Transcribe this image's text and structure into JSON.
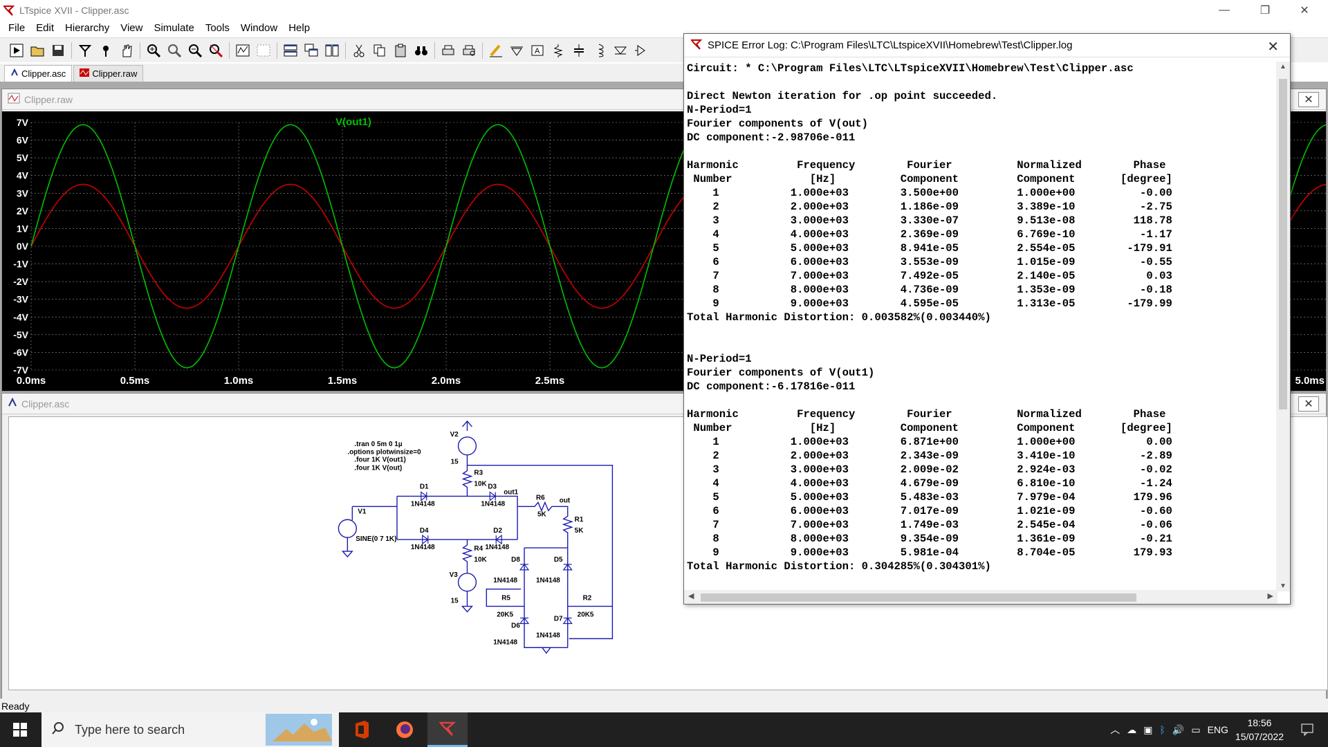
{
  "window": {
    "title": "LTspice XVII - Clipper.asc",
    "minimize": "—",
    "restore": "❐",
    "close": "✕"
  },
  "menu": [
    "File",
    "Edit",
    "Hierarchy",
    "View",
    "Simulate",
    "Tools",
    "Window",
    "Help"
  ],
  "tabs": [
    {
      "label": "Clipper.asc"
    },
    {
      "label": "Clipper.raw"
    }
  ],
  "waveform": {
    "caption": "Clipper.raw",
    "trace_label": "V(out1)",
    "colors": {
      "background": "#000000",
      "grid": "#9a9a9a",
      "trace_out1": "#00c000",
      "trace_out": "#cc0000",
      "label": "#00c000"
    },
    "chart_data": {
      "type": "line",
      "xlim": [
        0,
        5
      ],
      "ylim": [
        -7,
        7
      ],
      "x_ticks": [
        "0.0ms",
        "0.5ms",
        "1.0ms",
        "1.5ms",
        "2.0ms",
        "2.5ms",
        "5.0ms"
      ],
      "y_ticks": [
        "7V",
        "6V",
        "5V",
        "4V",
        "3V",
        "2V",
        "1V",
        "0V",
        "-1V",
        "-2V",
        "-3V",
        "-4V",
        "-5V",
        "-6V",
        "-7V"
      ],
      "series": [
        {
          "name": "V(out1)",
          "amplitude": 6.871,
          "frequency_khz": 1,
          "color": "#00c000"
        },
        {
          "amplitude": 3.5,
          "frequency_khz": 1,
          "color": "#cc0000"
        }
      ]
    }
  },
  "schematic": {
    "caption": "Clipper.asc",
    "directives": [
      ".tran 0 5m 0 1µ",
      ".options plotwinsize=0",
      ".four 1K V(out1)",
      ".four 1K V(out)"
    ],
    "labels": {
      "V1": "V1",
      "V1_val": "SINE(0 7 1K)",
      "V2": "V2",
      "V2_val": "15",
      "V3": "V3",
      "V3_val": "15",
      "R1": "R1",
      "R1_val": "5K",
      "R2": "R2",
      "R2_val": "20K5",
      "R3": "R3",
      "R3_val": "10K",
      "R4": "R4",
      "R4_val": "10K",
      "R5": "R5",
      "R5_val": "20K5",
      "R6": "R6",
      "R6_val": "5K",
      "D1": "D1",
      "D2": "D2",
      "D3": "D3",
      "D4": "D4",
      "D5": "D5",
      "D6": "D6",
      "D7": "D7",
      "D8": "D8",
      "diode_model": "1N4148",
      "net_out1": "out1",
      "net_out": "out"
    }
  },
  "log": {
    "title": "SPICE Error Log: C:\\Program Files\\LTC\\LtspiceXVII\\Homebrew\\Test\\Clipper.log",
    "close": "✕",
    "lines": [
      "Circuit: * C:\\Program Files\\LTC\\LTspiceXVII\\Homebrew\\Test\\Clipper.asc",
      "",
      "Direct Newton iteration for .op point succeeded.",
      "N-Period=1",
      "Fourier components of V(out)",
      "DC component:-2.98706e-011",
      "",
      "Harmonic         Frequency        Fourier          Normalized        Phase",
      " Number            [Hz]          Component         Component       [degree]",
      "    1           1.000e+03        3.500e+00         1.000e+00          -0.00",
      "    2           2.000e+03        1.186e-09         3.389e-10          -2.75",
      "    3           3.000e+03        3.330e-07         9.513e-08         118.78",
      "    4           4.000e+03        2.369e-09         6.769e-10          -1.17",
      "    5           5.000e+03        8.941e-05         2.554e-05        -179.91",
      "    6           6.000e+03        3.553e-09         1.015e-09          -0.55",
      "    7           7.000e+03        7.492e-05         2.140e-05           0.03",
      "    8           8.000e+03        4.736e-09         1.353e-09          -0.18",
      "    9           9.000e+03        4.595e-05         1.313e-05        -179.99",
      "Total Harmonic Distortion: 0.003582%(0.003440%)",
      "",
      "",
      "N-Period=1",
      "Fourier components of V(out1)",
      "DC component:-6.17816e-011",
      "",
      "Harmonic         Frequency        Fourier          Normalized        Phase",
      " Number            [Hz]          Component         Component       [degree]",
      "    1           1.000e+03        6.871e+00         1.000e+00           0.00",
      "    2           2.000e+03        2.343e-09         3.410e-10          -2.89",
      "    3           3.000e+03        2.009e-02         2.924e-03          -0.02",
      "    4           4.000e+03        4.679e-09         6.810e-10          -1.24",
      "    5           5.000e+03        5.483e-03         7.979e-04         179.96",
      "    6           6.000e+03        7.017e-09         1.021e-09          -0.60",
      "    7           7.000e+03        1.749e-03         2.545e-04          -0.06",
      "    8           8.000e+03        9.354e-09         1.361e-09          -0.21",
      "    9           9.000e+03        5.981e-04         8.704e-05         179.93",
      "Total Harmonic Distortion: 0.304285%(0.304301%)"
    ]
  },
  "status": {
    "text": "Ready"
  },
  "taskbar": {
    "search_placeholder": "Type here to search",
    "lang": "ENG",
    "time": "18:56",
    "date": "15/07/2022"
  }
}
